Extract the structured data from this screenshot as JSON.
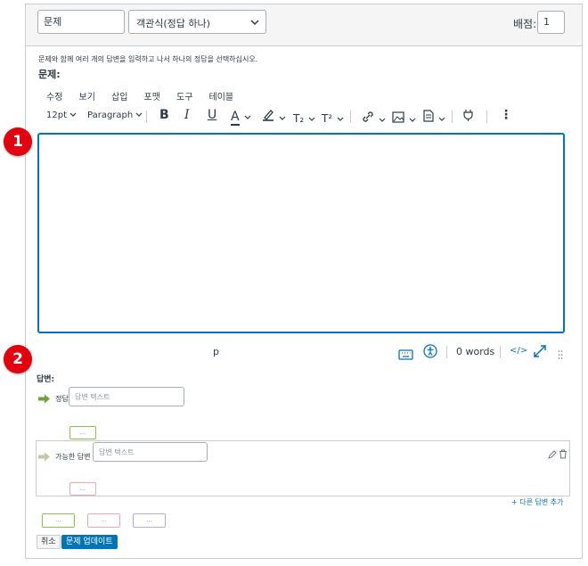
{
  "header": {
    "title_value": "문제",
    "type_select": "객관식(정답 하나)",
    "points_label": "배점:",
    "points_value": "1"
  },
  "instructions": "문제와 함께 여러 개의 답변을 입력하고 나서 하나의 정답을 선택하십시오.",
  "question_label": "문제:",
  "menu": [
    "수정",
    "보기",
    "삽입",
    "포맷",
    "도구",
    "테이블"
  ],
  "toolbar": {
    "font_size": "12pt",
    "block_format": "Paragraph",
    "bold": "B",
    "italic": "I",
    "underline": "U",
    "text_color": "A",
    "subscript": "T₂",
    "superscript": "T²",
    "more": "⋮"
  },
  "statusbar": {
    "path": "p",
    "word_count": "0 words",
    "html_toggle": "</>"
  },
  "badges": [
    "1",
    "2"
  ],
  "answers": {
    "label": "답변:",
    "correct_label": "정답",
    "correct_placeholder": "답변 텍스트",
    "possible_label": "가능한 답변",
    "possible_placeholder": "답변 텍스트",
    "add_another": "+ 다른 답변 추가",
    "ellipsis": "..."
  },
  "buttons": {
    "cancel": "취소",
    "update": "문제 업데이트"
  },
  "colors": {
    "accent": "#0374b5",
    "badge": "#e3000f",
    "correct_arrow": "#6ba33b",
    "chip_green": "#8bc34a",
    "chip_red": "#f4a7b0",
    "chip_purple": "#b8a8e8"
  }
}
